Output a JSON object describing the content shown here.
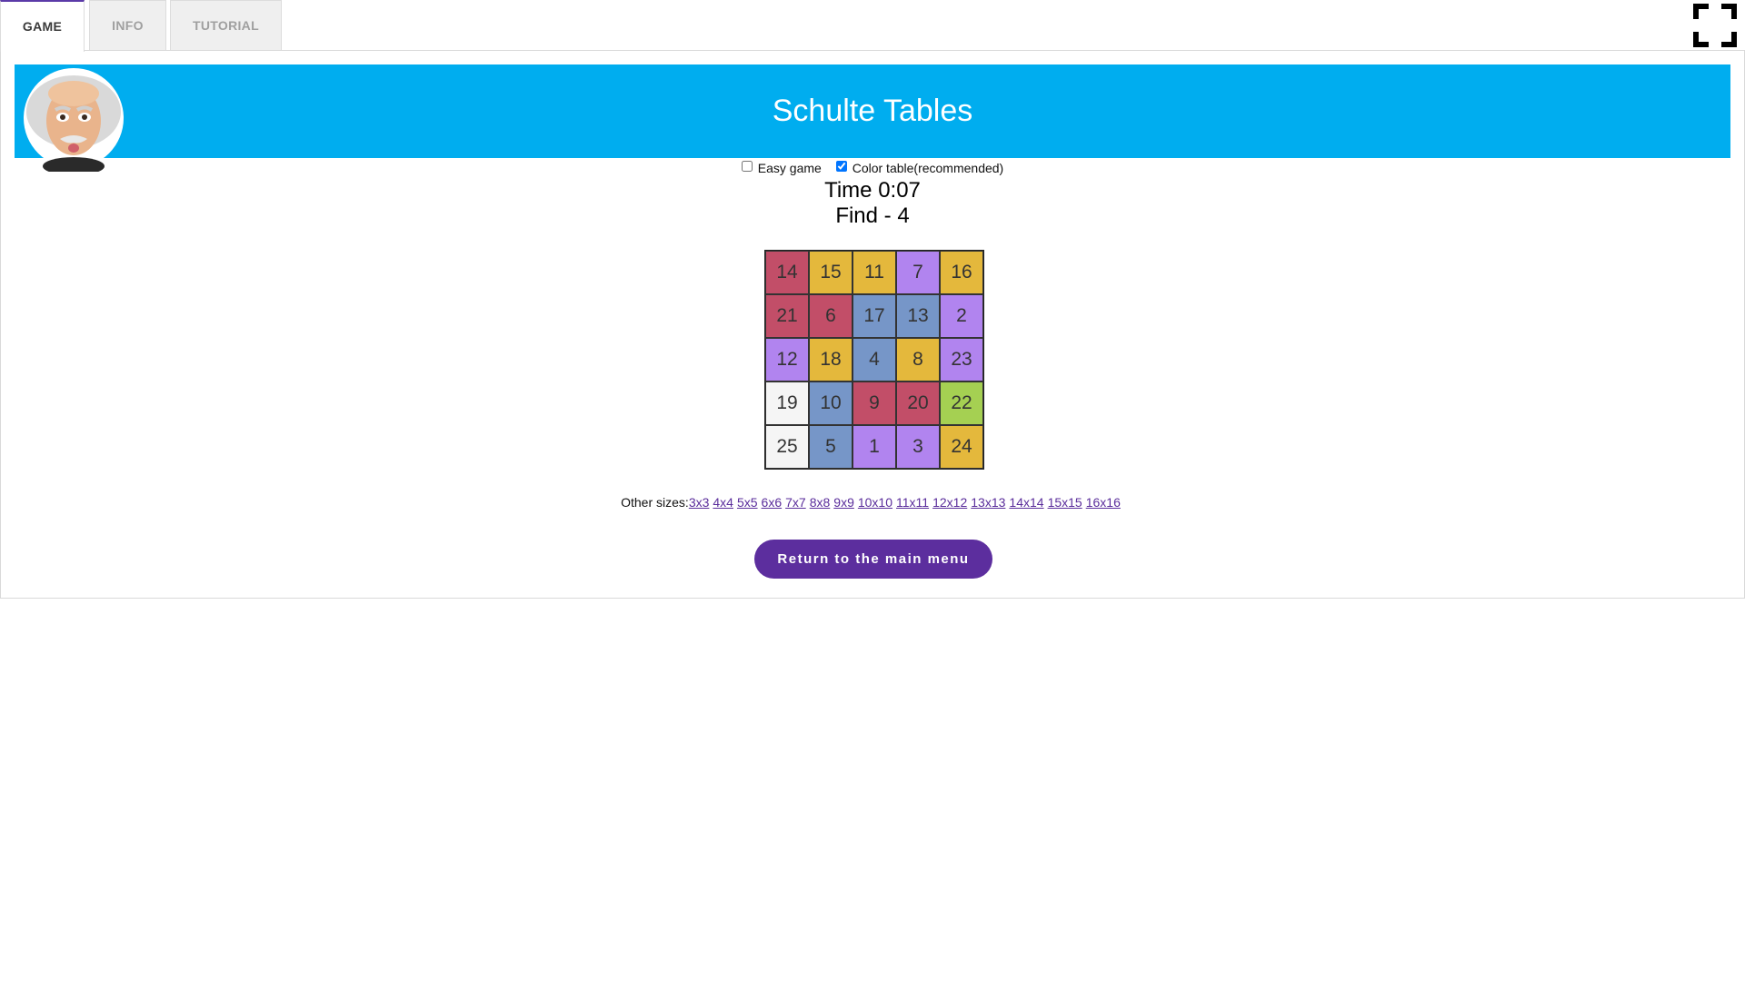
{
  "tabs": [
    {
      "label": "GAME",
      "active": true
    },
    {
      "label": "INFO",
      "active": false
    },
    {
      "label": "TUTORIAL",
      "active": false
    }
  ],
  "fullscreen_icon": "fullscreen-icon",
  "banner": {
    "title": "Schulte Tables",
    "color": "#00adef",
    "avatar_icon": "einstein-avatar"
  },
  "options": {
    "easy_game": {
      "label": "Easy game",
      "checked": false
    },
    "color_table": {
      "label": "Color table(recommended)",
      "checked": true
    }
  },
  "status": {
    "time": "Time 0:07",
    "find": "Find - 4"
  },
  "colors": {
    "red": "#c24e68",
    "yellow": "#e4b83c",
    "purple": "#b184ef",
    "blue": "#7696c8",
    "white": "#f5f5f5",
    "green": "#a5d052"
  },
  "grid": {
    "size": 5,
    "cells": [
      {
        "n": "14",
        "c": "red"
      },
      {
        "n": "15",
        "c": "yellow"
      },
      {
        "n": "11",
        "c": "yellow"
      },
      {
        "n": "7",
        "c": "purple"
      },
      {
        "n": "16",
        "c": "yellow"
      },
      {
        "n": "21",
        "c": "red"
      },
      {
        "n": "6",
        "c": "red"
      },
      {
        "n": "17",
        "c": "blue"
      },
      {
        "n": "13",
        "c": "blue"
      },
      {
        "n": "2",
        "c": "purple"
      },
      {
        "n": "12",
        "c": "purple"
      },
      {
        "n": "18",
        "c": "yellow"
      },
      {
        "n": "4",
        "c": "blue"
      },
      {
        "n": "8",
        "c": "yellow"
      },
      {
        "n": "23",
        "c": "purple"
      },
      {
        "n": "19",
        "c": "white"
      },
      {
        "n": "10",
        "c": "blue"
      },
      {
        "n": "9",
        "c": "red"
      },
      {
        "n": "20",
        "c": "red"
      },
      {
        "n": "22",
        "c": "green"
      },
      {
        "n": "25",
        "c": "white"
      },
      {
        "n": "5",
        "c": "blue"
      },
      {
        "n": "1",
        "c": "purple"
      },
      {
        "n": "3",
        "c": "purple"
      },
      {
        "n": "24",
        "c": "yellow"
      }
    ]
  },
  "other_sizes": {
    "label": "Other sizes:",
    "links": [
      "3x3",
      "4x4",
      "5x5",
      "6x6",
      "7x7",
      "8x8",
      "9x9",
      "10x10",
      "11x11",
      "12x12",
      "13x13",
      "14x14",
      "15x15",
      "16x16"
    ]
  },
  "menu_button": {
    "label": "Return to the main menu"
  }
}
